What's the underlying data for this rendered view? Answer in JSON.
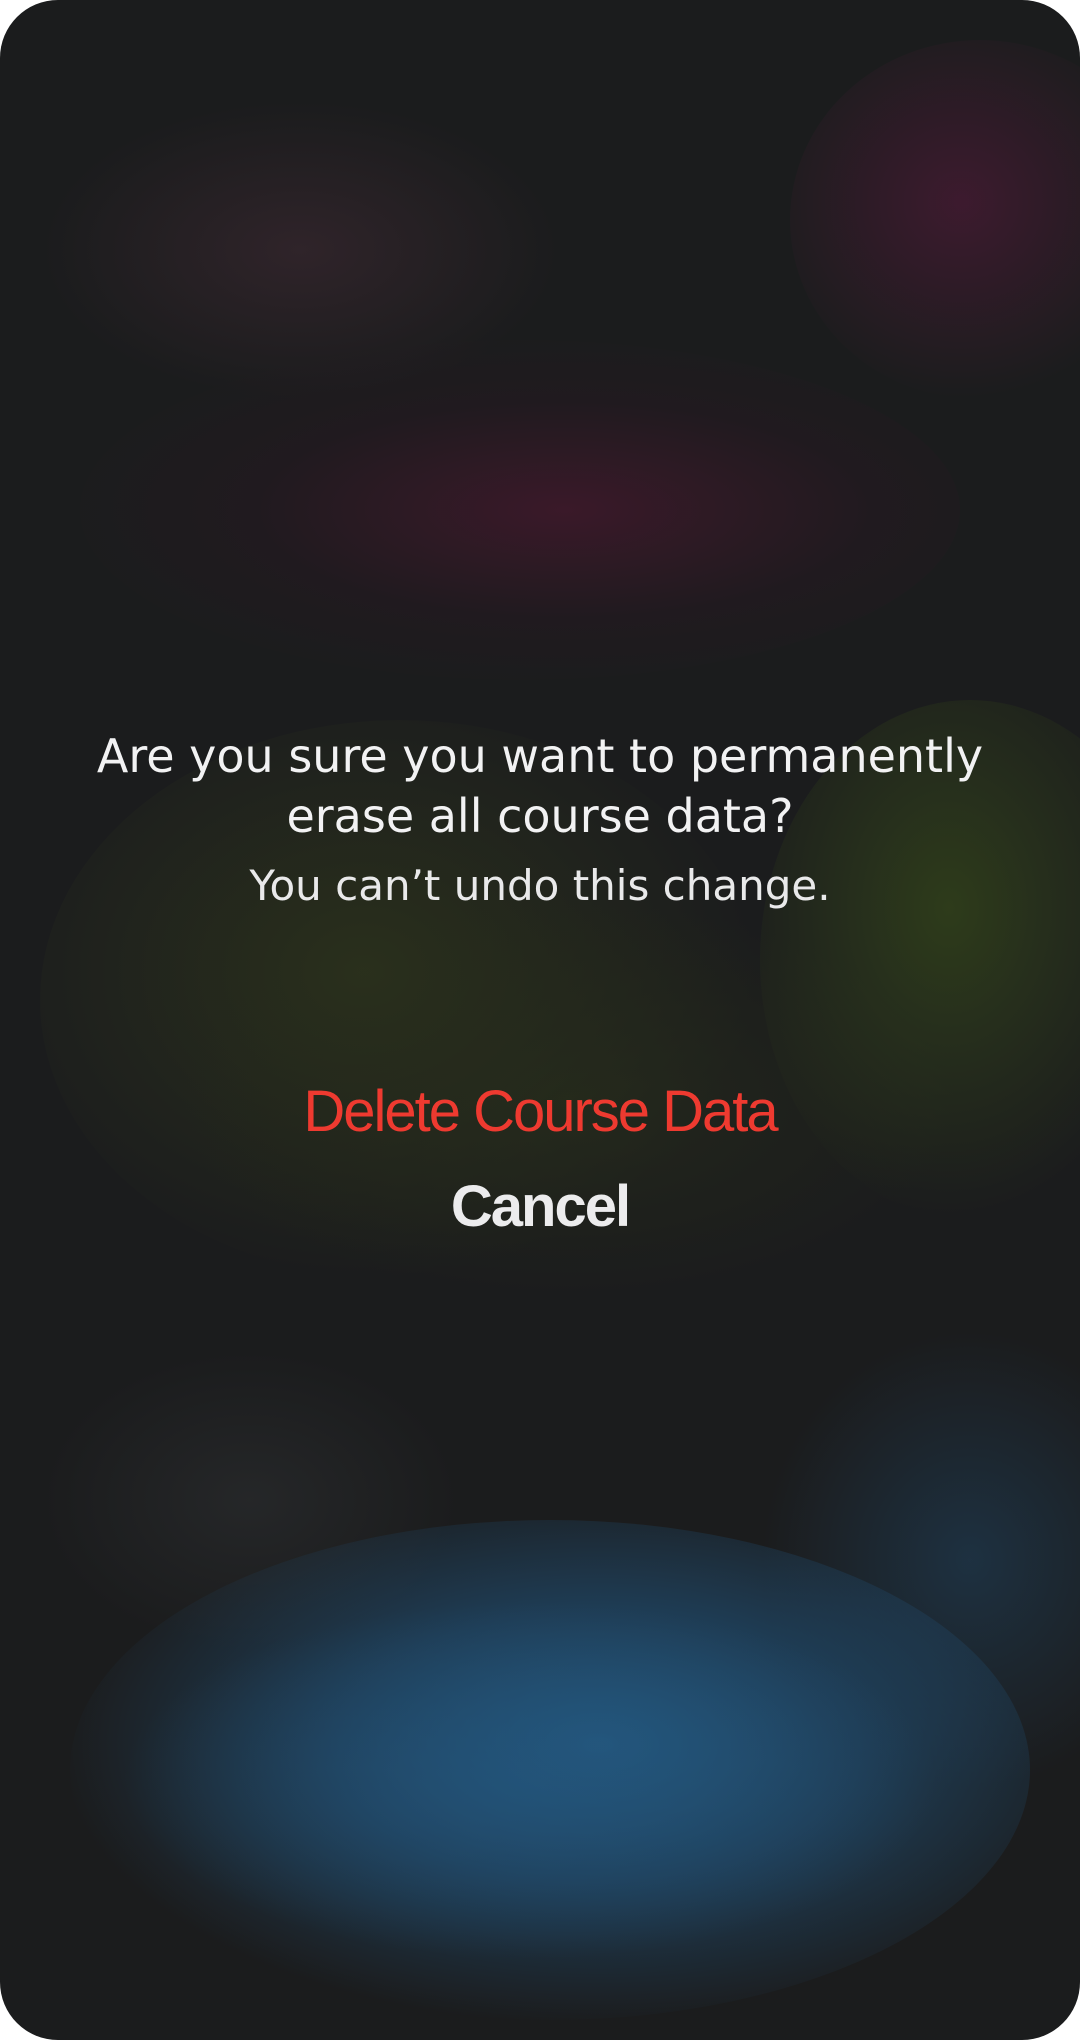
{
  "alert": {
    "title": "Are you sure you want to permanently erase all course data?",
    "message": "You can’t undo this change."
  },
  "actions": {
    "delete_label": "Delete Course Data",
    "cancel_label": "Cancel"
  },
  "colors": {
    "destructive": "#ee3a30",
    "background": "#1b1c1d",
    "text": "#f2f2f3"
  }
}
